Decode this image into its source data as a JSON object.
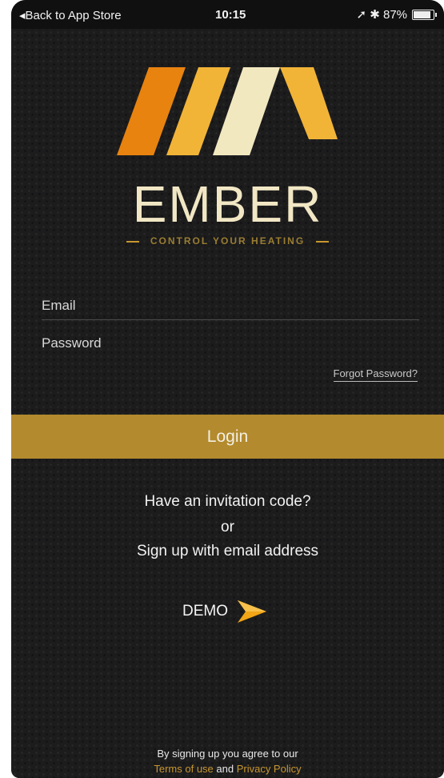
{
  "status_bar": {
    "back_label": "◂Back to App Store",
    "time": "10:15",
    "indicators": "➚ ✱ 87%"
  },
  "brand": {
    "name": "EMBER",
    "tagline": "CONTROL YOUR HEATING",
    "colors": {
      "orange": "#e8830f",
      "gold": "#f2b437",
      "cream": "#f2e8c0",
      "accent": "#b38a2d"
    }
  },
  "form": {
    "email_placeholder": "Email",
    "email_value": "",
    "password_placeholder": "Password",
    "password_value": "",
    "forgot_label": "Forgot Password?",
    "login_label": "Login"
  },
  "links": {
    "invitation": "Have an invitation code?",
    "or": "or",
    "signup": "Sign up with email address",
    "demo": "DEMO"
  },
  "footer": {
    "line1": "By signing up you agree to our",
    "terms": "Terms of use",
    "and": " and ",
    "privacy": "Privacy Policy"
  }
}
